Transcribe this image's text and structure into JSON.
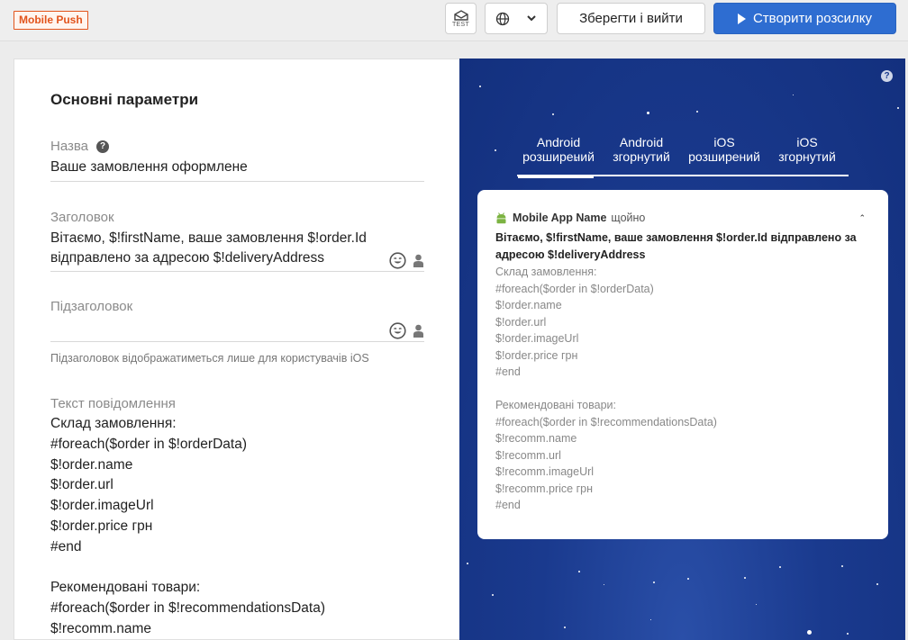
{
  "topbar": {
    "badge": "Mobile Push",
    "test_label": "TEST",
    "save_label": "Зберегти і вийти",
    "create_label": "Створити розсилку"
  },
  "form": {
    "section_title": "Основні параметри",
    "name_label": "Назва",
    "name_value": "Ваше замовлення оформлене",
    "title_label": "Заголовок",
    "title_value_line1": "Вітаємо, $!firstName, ваше замовлення $!order.Id",
    "title_value_line2": "відправлено за адресою $!deliveryAddress",
    "subtitle_label": "Підзаголовок",
    "subtitle_hint": "Підзаголовок відображатиметься лише для користувачів iOS",
    "message_label": "Текст повідомлення",
    "message_text": "Склад замовлення:\n#foreach($order in $!orderData)\n$!order.name\n$!order.url\n$!order.imageUrl\n$!order.price грн\n#end\n\nРекомендовані товари:\n#foreach($order in $!recommendationsData)\n$!recomm.name"
  },
  "preview": {
    "tabs": [
      {
        "line1": "Android",
        "line2": "розширений"
      },
      {
        "line1": "Android",
        "line2": "згорнутий"
      },
      {
        "line1": "iOS",
        "line2": "розширений"
      },
      {
        "line1": "iOS",
        "line2": "згорнутий"
      }
    ],
    "card": {
      "app_name": "Mobile App Name",
      "time": "щойно",
      "title": "Вітаємо, $!firstName, ваше замовлення $!order.Id відправлено за адресою $!deliveryAddress",
      "body": "Склад замовлення:\n#foreach($order in $!orderData)\n$!order.name\n$!order.url\n$!order.imageUrl\n$!order.price грн\n#end\n\nРекомендовані товари:\n#foreach($order in $!recommendationsData)\n$!recomm.name\n$!recomm.url\n$!recomm.imageUrl\n$!recomm.price грн\n#end"
    }
  },
  "colors": {
    "accent": "#2e6dd1",
    "badge": "#e2541c",
    "preview_bg": "#1a3a8e"
  }
}
